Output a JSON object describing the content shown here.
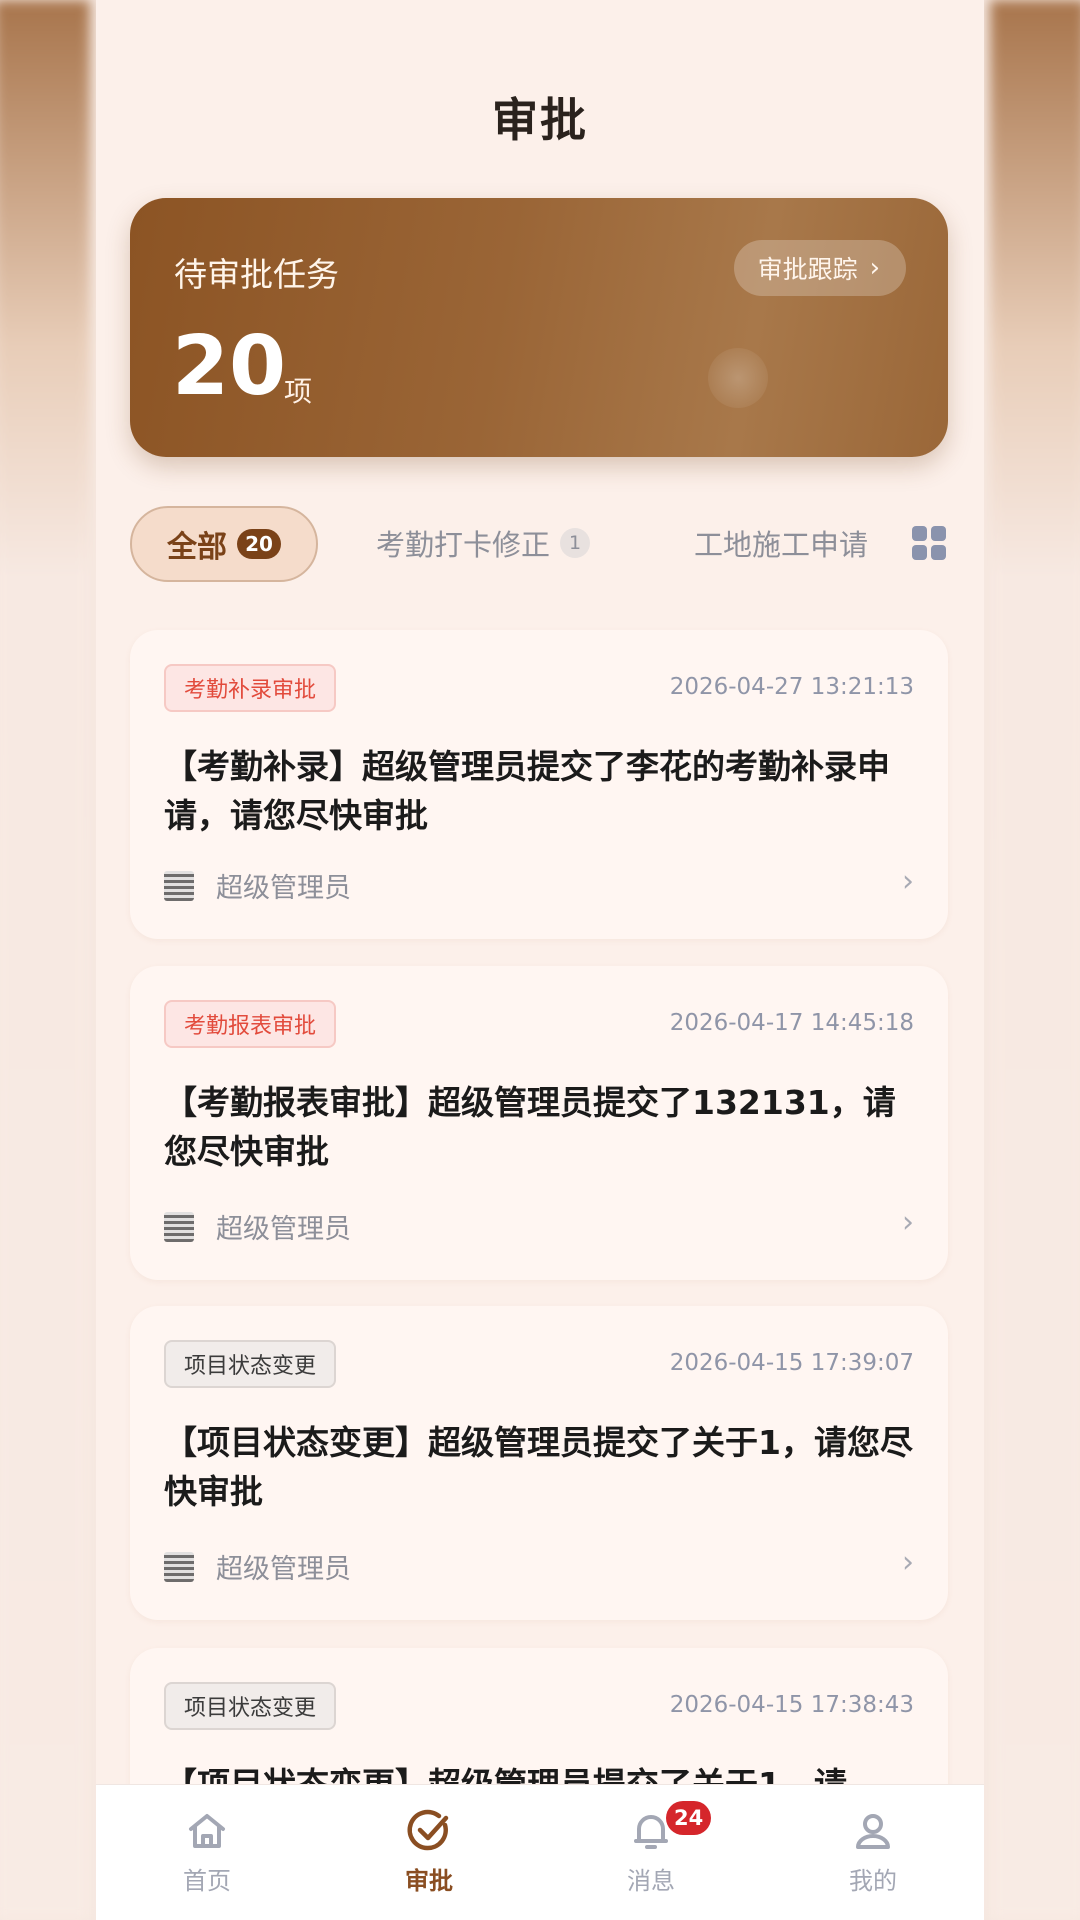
{
  "page": {
    "title": "审批"
  },
  "summary": {
    "label": "待审批任务",
    "count": "20",
    "unit": "项",
    "track_button": "审批跟踪"
  },
  "tabs": [
    {
      "label": "全部",
      "count": "20",
      "active": true
    },
    {
      "label": "考勤打卡修正",
      "count": "1"
    },
    {
      "label": "工地施工申请"
    }
  ],
  "cards": [
    {
      "tag": "考勤补录审批",
      "tag_color": "#e24b3c",
      "time": "2026-04-27 13:21:13",
      "title": "【考勤补录】超级管理员提交了李花的考勤补录申请，请您尽快审批",
      "submitter": "超级管理员"
    },
    {
      "tag": "考勤报表审批",
      "tag_color": "#e24b3c",
      "time": "2026-04-17 14:45:18",
      "title": "【考勤报表审批】超级管理员提交了132131，请您尽快审批",
      "submitter": "超级管理员"
    },
    {
      "tag": "项目状态变更",
      "tag_color": "#3b3b3b",
      "time": "2026-04-15 17:39:07",
      "title": "【项目状态变更】超级管理员提交了关于1，请您尽快审批",
      "submitter": "超级管理员"
    },
    {
      "tag": "项目状态变更",
      "tag_color": "#3b3b3b",
      "time": "2026-04-15 17:38:43",
      "title": "【项目状态变更】超级管理员提交了关于1，请",
      "submitter": ""
    }
  ],
  "nav": [
    {
      "label": "首页",
      "icon": "home-icon"
    },
    {
      "label": "审批",
      "icon": "check-circle-icon",
      "active": true
    },
    {
      "label": "消息",
      "icon": "bell-icon",
      "badge": "24"
    },
    {
      "label": "我的",
      "icon": "user-icon"
    }
  ],
  "colors": {
    "accent": "#8a4e22",
    "badge": "#d5262b",
    "tag_red": "#e24b3c"
  }
}
